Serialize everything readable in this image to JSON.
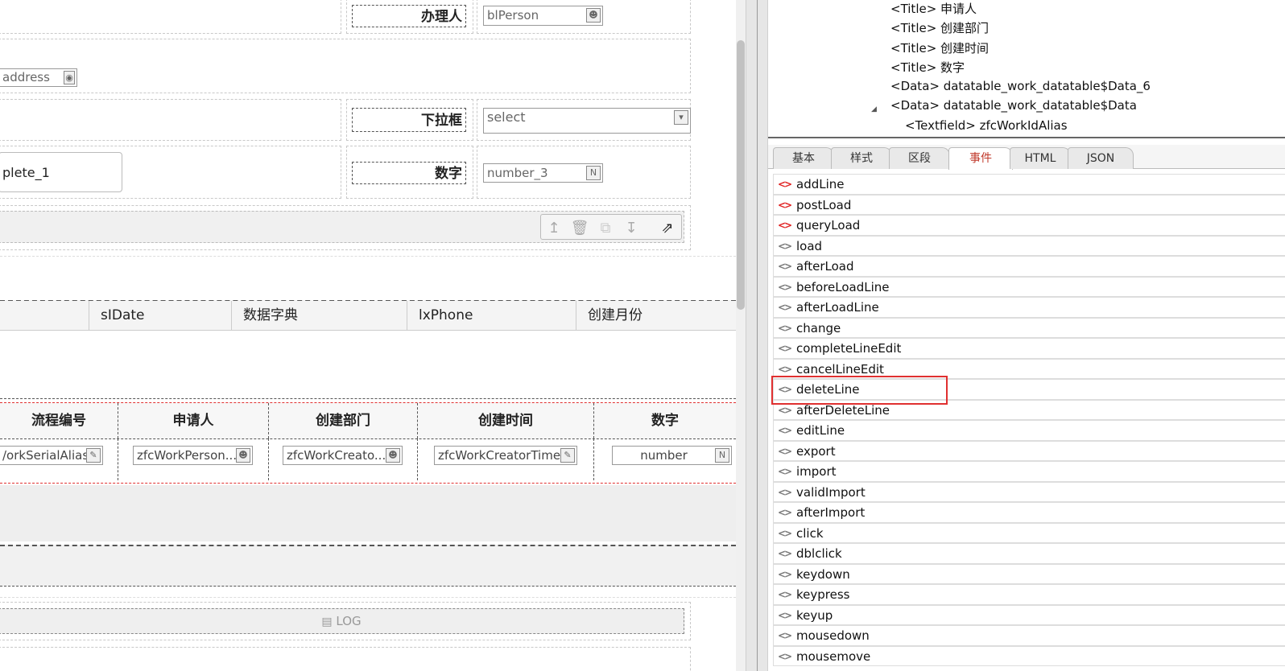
{
  "form": {
    "field_person_label": "办理人",
    "field_person_value": "blPerson",
    "field_address_value": "address",
    "field_select_label": "下拉框",
    "field_select_value": "select",
    "field_autocomplete_value": "plete_1",
    "field_number_label": "数字",
    "field_number_value": "number_3"
  },
  "toolbar_icons": [
    "upload-icon",
    "delete-icon",
    "copy-icon",
    "download-icon",
    "external-link-icon"
  ],
  "table1": {
    "columns": [
      "sIDate",
      "数据字典",
      "lxPhone",
      "创建月份"
    ]
  },
  "grid": {
    "columns": [
      "流程编号",
      "申请人",
      "创建部门",
      "创建时间",
      "数字"
    ],
    "cells": [
      "/orkSerialAlias",
      "zfcWorkPerson...",
      "zfcWorkCreato...",
      "zfcWorkCreatorTime",
      "number"
    ]
  },
  "log_label": "LOG",
  "tree": {
    "nodes": [
      "<Title> 申请人",
      "<Title> 创建部门",
      "<Title> 创建时间",
      "<Title> 数字",
      "<Data> datatable_work_datatable$Data_6",
      "<Data> datatable_work_datatable$Data",
      "<Textfield> zfcWorkIdAlias"
    ]
  },
  "tabs": [
    "基本",
    "样式",
    "区段",
    "事件",
    "HTML",
    "JSON"
  ],
  "active_tab": "事件",
  "events": [
    {
      "name": "addLine",
      "set": true
    },
    {
      "name": "postLoad",
      "set": true
    },
    {
      "name": "queryLoad",
      "set": true
    },
    {
      "name": "load",
      "set": false
    },
    {
      "name": "afterLoad",
      "set": false
    },
    {
      "name": "beforeLoadLine",
      "set": false
    },
    {
      "name": "afterLoadLine",
      "set": false
    },
    {
      "name": "change",
      "set": false
    },
    {
      "name": "completeLineEdit",
      "set": false
    },
    {
      "name": "cancelLineEdit",
      "set": false
    },
    {
      "name": "deleteLine",
      "set": false
    },
    {
      "name": "afterDeleteLine",
      "set": false
    },
    {
      "name": "editLine",
      "set": false
    },
    {
      "name": "export",
      "set": false
    },
    {
      "name": "import",
      "set": false
    },
    {
      "name": "validImport",
      "set": false
    },
    {
      "name": "afterImport",
      "set": false
    },
    {
      "name": "click",
      "set": false
    },
    {
      "name": "dblclick",
      "set": false
    },
    {
      "name": "keydown",
      "set": false
    },
    {
      "name": "keypress",
      "set": false
    },
    {
      "name": "keyup",
      "set": false
    },
    {
      "name": "mousedown",
      "set": false
    },
    {
      "name": "mousemove",
      "set": false
    }
  ],
  "code_glyph": "<>",
  "colors": {
    "set_event": "#e02020",
    "highlight": "#e03030",
    "active_tab": "#c0392b"
  }
}
